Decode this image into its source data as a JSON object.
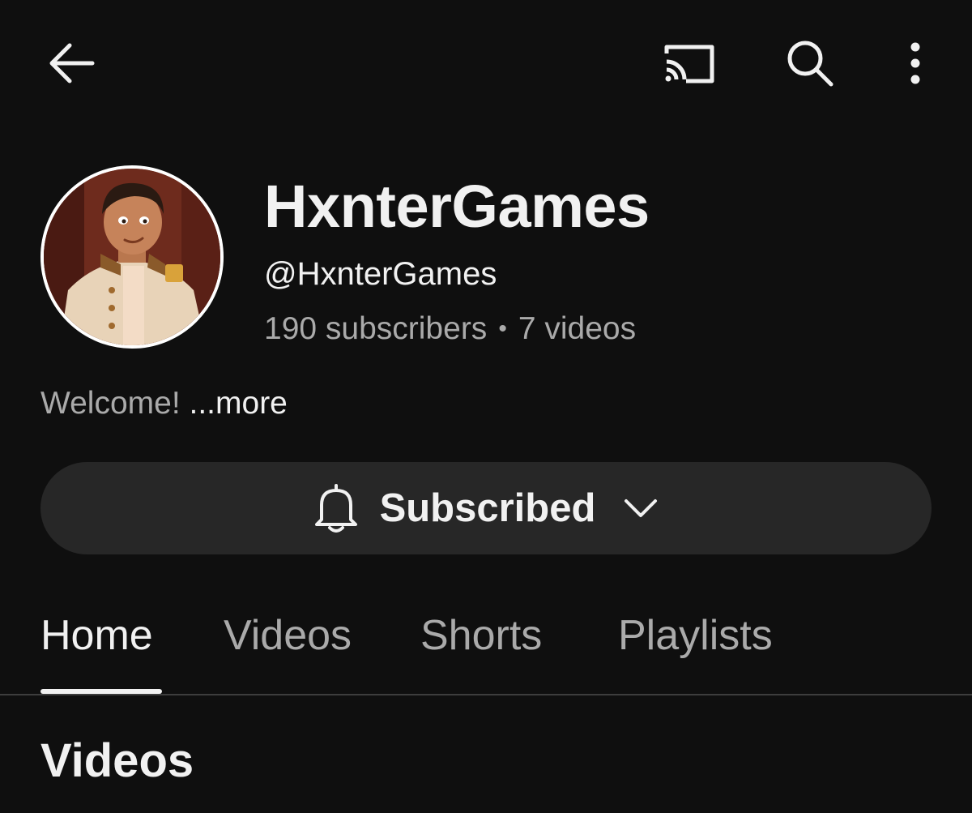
{
  "topbar": {
    "back_icon": "arrow-left-icon",
    "cast_icon": "cast-icon",
    "search_icon": "search-icon",
    "more_icon": "more-vertical-icon"
  },
  "channel": {
    "name": "HxnterGames",
    "handle": "@HxnterGames",
    "subscribers": "190 subscribers",
    "separator": "•",
    "videos": "7 videos",
    "description": "Welcome!",
    "more_label": "...more"
  },
  "subscribe": {
    "label": "Subscribed",
    "bell_icon": "bell-icon",
    "chevron_icon": "chevron-down-icon"
  },
  "tabs": [
    {
      "label": "Home",
      "active": true
    },
    {
      "label": "Videos",
      "active": false
    },
    {
      "label": "Shorts",
      "active": false
    },
    {
      "label": "Playlists",
      "active": false
    }
  ],
  "section": {
    "title": "Videos"
  },
  "colors": {
    "background": "#0f0f0f",
    "button_bg": "#272727",
    "text_primary": "#f1f1f1",
    "text_secondary": "#aaaaaa"
  }
}
